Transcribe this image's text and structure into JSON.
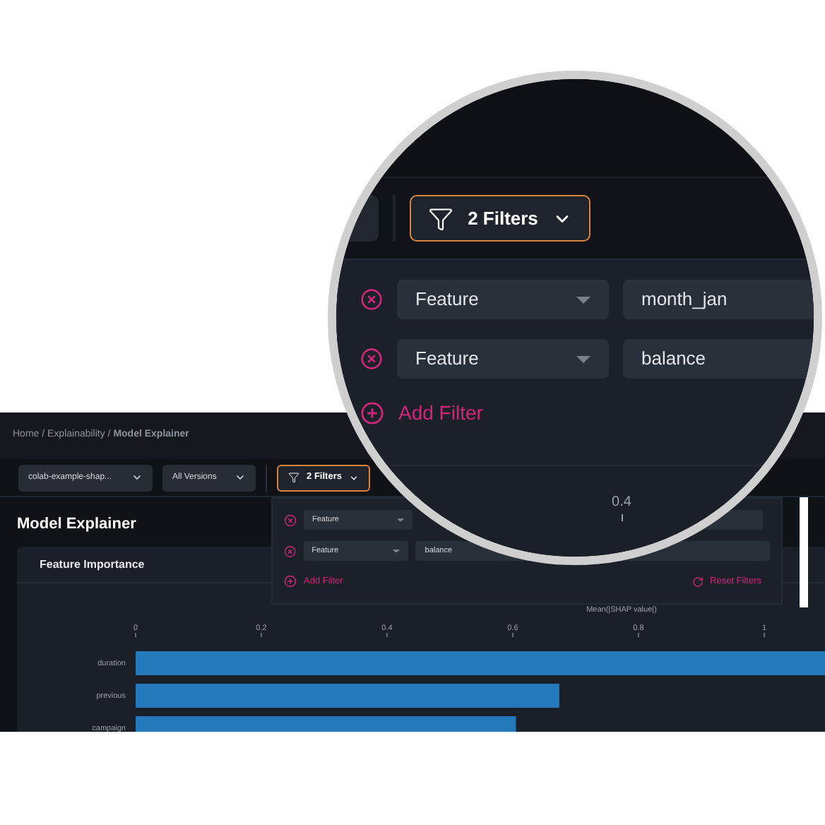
{
  "breadcrumb": "Home / Explainability / **Model Explainer**",
  "toolbar": {
    "model": "colab-example-shap...",
    "version": "All Versions",
    "filter_button": "2 Filters",
    "filter_active": true
  },
  "page_title": "Model Explainer",
  "filter_panel": {
    "rows": [
      {
        "field": "Feature"
      },
      {
        "field": "Feature",
        "value": "balance"
      }
    ],
    "add": "Add Filter",
    "reset": "Reset Filters"
  },
  "card": {
    "title": "Feature Importance",
    "chart_data": {
      "type": "bar",
      "orientation": "horizontal",
      "xlabel": "Mean(|SHAP value|)",
      "categories": [
        "duration",
        "previous",
        "campaign"
      ],
      "values": [
        1.1,
        0.674,
        0.605
      ],
      "xlim": [
        0,
        1.1
      ],
      "xticks": [
        0,
        0.2,
        0.4,
        0.6,
        0.8,
        1
      ]
    }
  },
  "magnifier": {
    "filter_button": "2 Filters",
    "filter_active": true,
    "rows": [
      {
        "field": "Feature",
        "value": "month_jan"
      },
      {
        "field": "Feature",
        "value": "balance"
      }
    ],
    "add": "Add Filter",
    "tick": "0.4"
  }
}
